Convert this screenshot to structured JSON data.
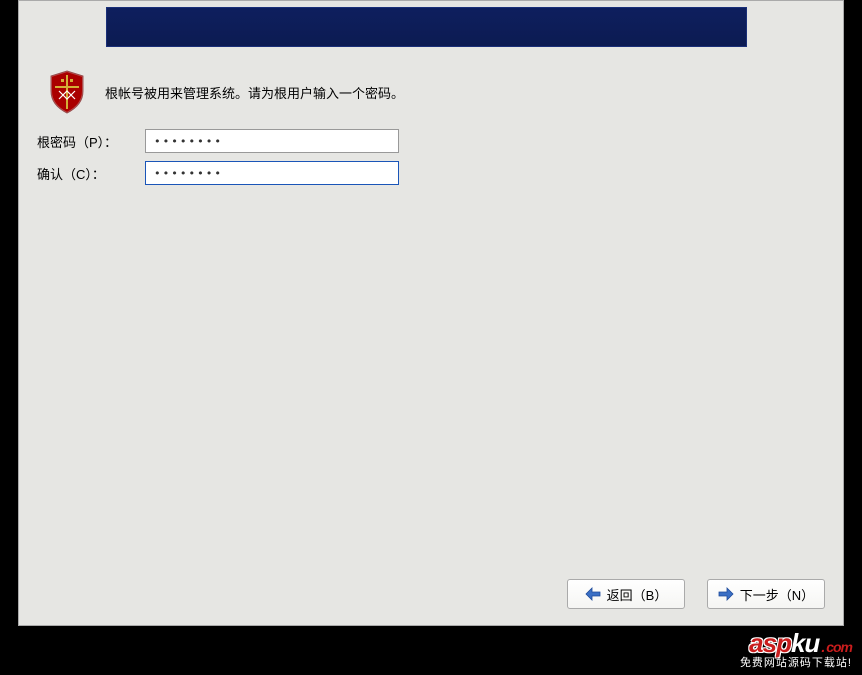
{
  "info": {
    "text": "根帐号被用来管理系统。请为根用户输入一个密码。"
  },
  "form": {
    "password_label": "根密码（P）：",
    "password_value": "••••••••",
    "confirm_label": "确认（C）：",
    "confirm_value": "••••••••"
  },
  "buttons": {
    "back_label": "返回（B）",
    "next_label": "下一步（N）"
  },
  "watermark": {
    "asp": "asp",
    "ku": "ku",
    "dot": ".",
    "com": "com",
    "subtitle": "免费网站源码下载站!"
  }
}
